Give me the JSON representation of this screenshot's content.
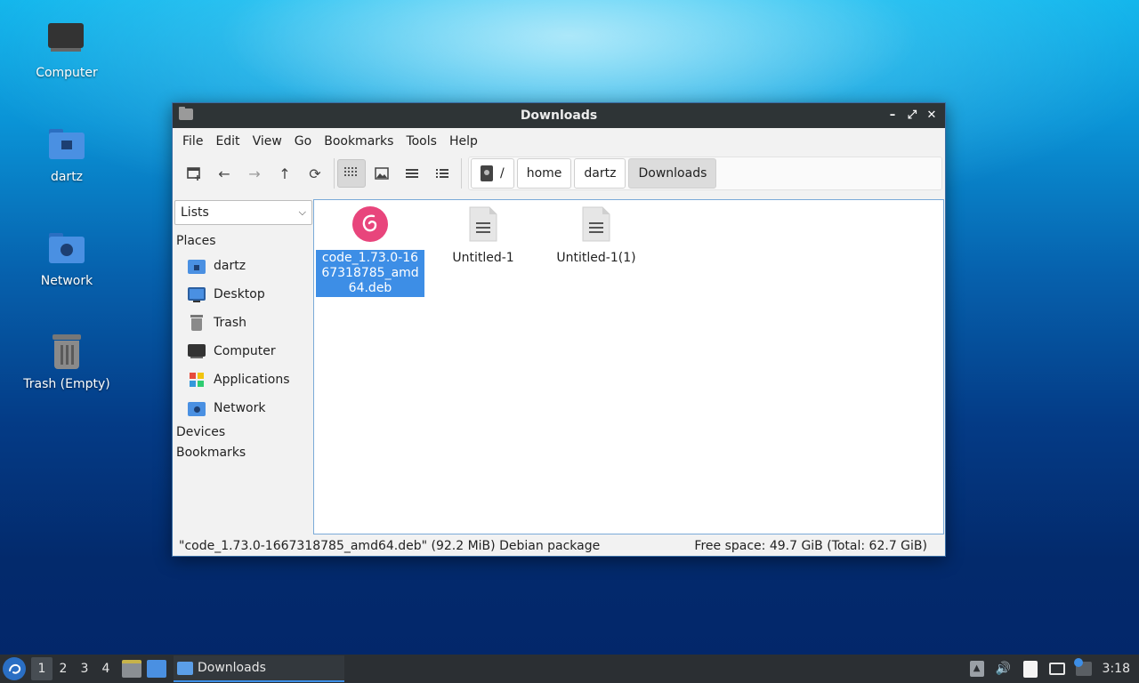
{
  "desktop": {
    "icons": [
      {
        "label": "Computer"
      },
      {
        "label": "dartz"
      },
      {
        "label": "Network"
      },
      {
        "label": "Trash (Empty)"
      }
    ]
  },
  "window": {
    "title": "Downloads",
    "controls": {
      "minimize": "–",
      "maximize": "⤢",
      "close": "✕"
    }
  },
  "menubar": {
    "items": [
      "File",
      "Edit",
      "View",
      "Go",
      "Bookmarks",
      "Tools",
      "Help"
    ]
  },
  "pathbar": {
    "crumbs": [
      "/",
      "home",
      "dartz",
      "Downloads"
    ]
  },
  "sidebar": {
    "view_select": "Lists",
    "places_heading": "Places",
    "places": [
      "dartz",
      "Desktop",
      "Trash",
      "Computer",
      "Applications",
      "Network"
    ],
    "devices_heading": "Devices",
    "bookmarks_heading": "Bookmarks"
  },
  "files": [
    {
      "name": "code_1.73.0-1667318785_amd64.deb",
      "selected": true
    },
    {
      "name": "Untitled-1",
      "selected": false
    },
    {
      "name": "Untitled-1(1)",
      "selected": false
    }
  ],
  "status": {
    "selection": "\"code_1.73.0-1667318785_amd64.deb\" (92.2 MiB) Debian package",
    "free_space": "Free space: 49.7 GiB (Total: 62.7 GiB)"
  },
  "taskbar": {
    "workspaces": [
      "1",
      "2",
      "3",
      "4"
    ],
    "active_workspace": "1",
    "task_label": "Downloads",
    "clock": "3:18"
  }
}
